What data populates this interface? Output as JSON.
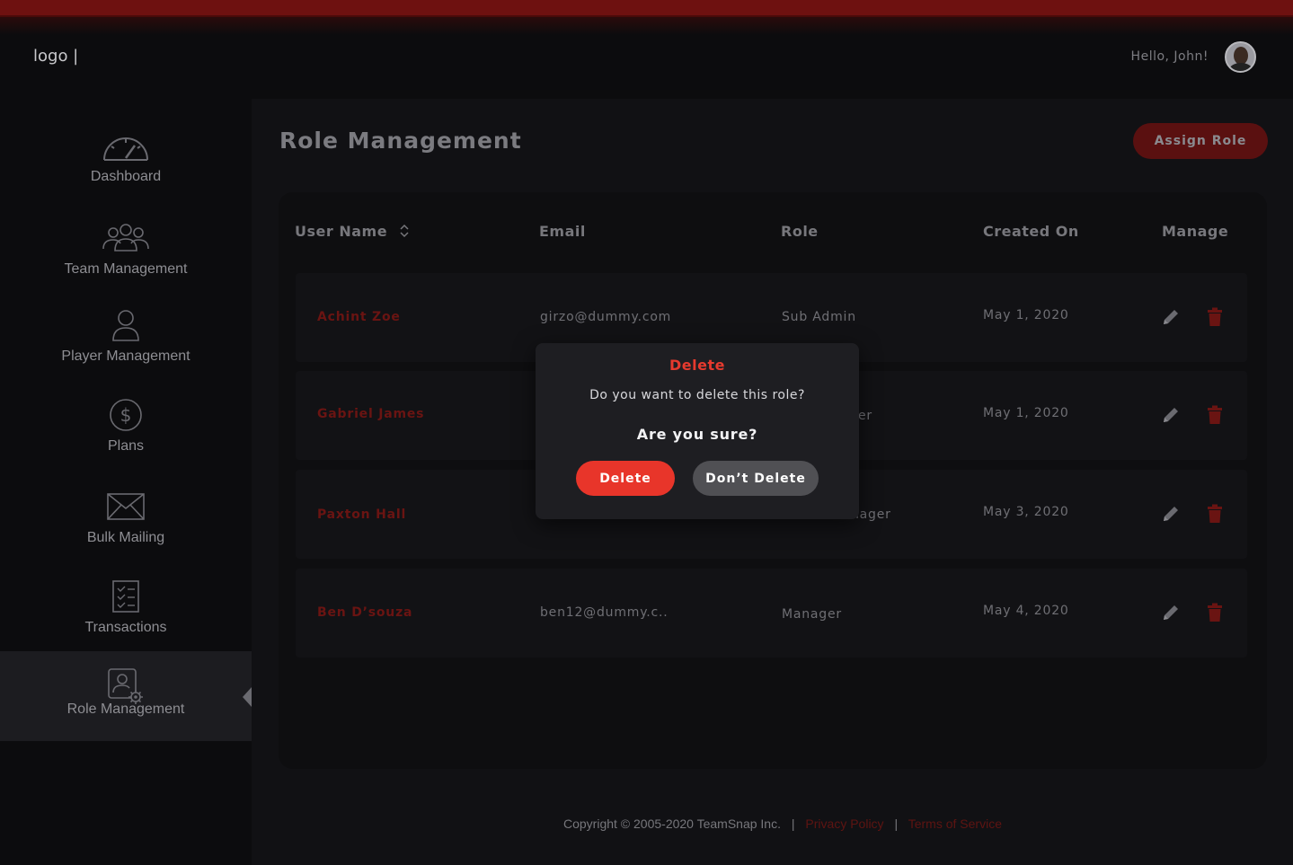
{
  "header": {
    "logo": "logo |",
    "greeting": "Hello, John!"
  },
  "sidebar": {
    "items": [
      {
        "label": "Dashboard",
        "icon": "speedometer-icon"
      },
      {
        "label": "Team Management",
        "icon": "team-icon"
      },
      {
        "label": "Player Management",
        "icon": "user-icon"
      },
      {
        "label": "Plans",
        "icon": "dollar-icon"
      },
      {
        "label": "Bulk Mailing",
        "icon": "envelope-icon"
      },
      {
        "label": "Transactions",
        "icon": "checklist-icon"
      },
      {
        "label": "Role Management",
        "icon": "user-settings-icon",
        "active": true
      }
    ]
  },
  "main": {
    "title": "Role Management",
    "assign_button": "Assign Role",
    "table": {
      "headers": {
        "user_name": "User Name",
        "email": "Email",
        "role": "Role",
        "created_on": "Created On",
        "manage": "Manage"
      },
      "rows": [
        {
          "name": "Achint Zoe",
          "email": "girzo@dummy.com",
          "role": "Sub Admin",
          "created": "May 1, 2020"
        },
        {
          "name": "Gabriel James",
          "email": "",
          "role": "er",
          "created": "May 1, 2020"
        },
        {
          "name": "Paxton Hall",
          "email": "",
          "role": "nager",
          "created": "May 3, 2020"
        },
        {
          "name": "Ben D’souza",
          "email": "ben12@dummy.c..",
          "role": "Manager",
          "created": "May 4, 2020"
        }
      ]
    }
  },
  "footer": {
    "copyright": "Copyright © 2005-2020 TeamSnap Inc.",
    "privacy": "Privacy Policy",
    "terms": "Terms of Service",
    "separator": "|"
  },
  "modal": {
    "title": "Delete",
    "message": "Do you want to delete this role?",
    "confirm": "Are you sure?",
    "delete_button": "Delete",
    "cancel_button": "Don’t Delete"
  },
  "colors": {
    "accent": "#e8352a",
    "accent_dim": "#6a1412",
    "background": "#0c0c0e"
  }
}
